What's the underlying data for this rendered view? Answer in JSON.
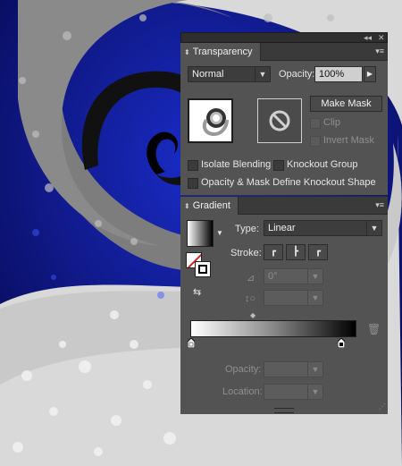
{
  "transparency": {
    "title": "Transparency",
    "blend_mode": "Normal",
    "opacity_label": "Opacity:",
    "opacity_value": "100%",
    "make_mask_label": "Make Mask",
    "clip_label": "Clip",
    "invert_mask_label": "Invert Mask",
    "isolate_blending_label": "Isolate Blending",
    "knockout_group_label": "Knockout Group",
    "opacity_mask_knockout_label": "Opacity & Mask Define Knockout Shape"
  },
  "gradient": {
    "title": "Gradient",
    "type_label": "Type:",
    "type_value": "Linear",
    "stroke_label": "Stroke:",
    "angle_value": "0°",
    "aspect_value": "",
    "opacity_label": "Opacity:",
    "location_label": "Location:"
  },
  "colors": {
    "panel_bg": "#535353",
    "artboard_bg": "#0a0f6e"
  },
  "icons": [
    "collapse-icon",
    "close-icon",
    "panel-menu-icon",
    "dropdown-arrow-icon",
    "next-arrow-icon",
    "no-mask-icon",
    "gradient-swatch-icon",
    "fill-stroke-icon",
    "reverse-gradient-icon",
    "angle-icon",
    "aspect-ratio-icon",
    "trash-icon",
    "midpoint-icon",
    "color-stop-icon"
  ]
}
